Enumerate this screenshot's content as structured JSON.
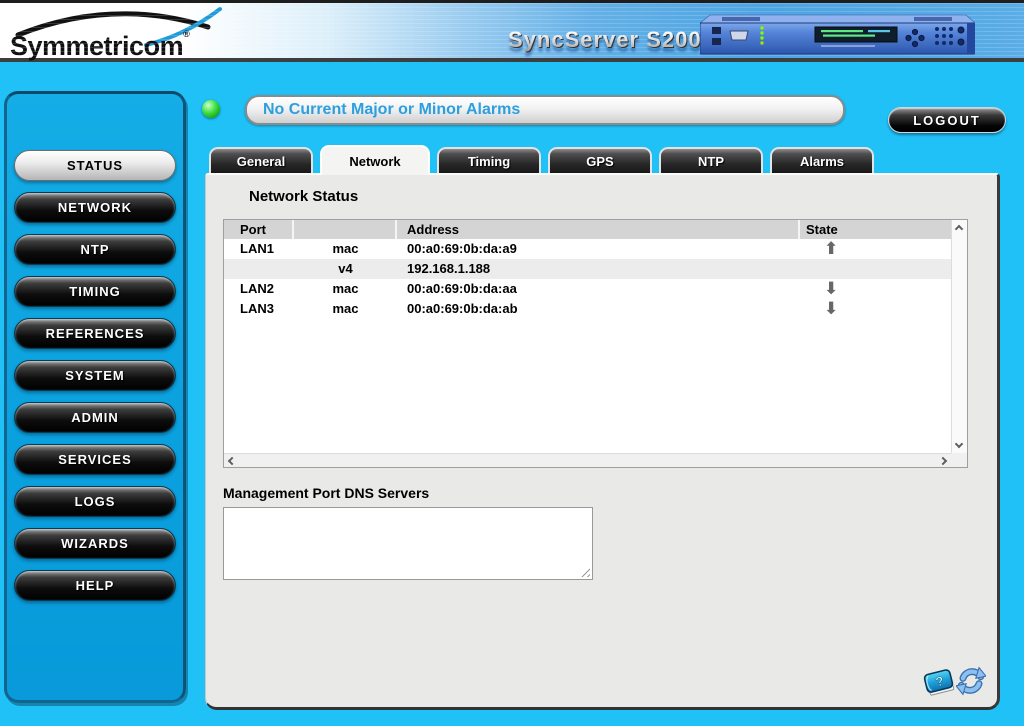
{
  "header": {
    "brand": "Symmetricom",
    "registered": "®",
    "product_title": "SyncServer S200"
  },
  "status_bar": {
    "alarm_text": "No Current Major or Minor Alarms",
    "led_state": "ok-green",
    "logout_label": "LOGOUT"
  },
  "sidebar": {
    "items": [
      {
        "label": "STATUS",
        "active": true
      },
      {
        "label": "NETWORK",
        "active": false
      },
      {
        "label": "NTP",
        "active": false
      },
      {
        "label": "TIMING",
        "active": false
      },
      {
        "label": "REFERENCES",
        "active": false
      },
      {
        "label": "SYSTEM",
        "active": false
      },
      {
        "label": "ADMIN",
        "active": false
      },
      {
        "label": "SERVICES",
        "active": false
      },
      {
        "label": "LOGS",
        "active": false
      },
      {
        "label": "WIZARDS",
        "active": false
      },
      {
        "label": "HELP",
        "active": false
      }
    ]
  },
  "tabs": {
    "items": [
      {
        "label": "General",
        "active": false
      },
      {
        "label": "Network",
        "active": true
      },
      {
        "label": "Timing",
        "active": false
      },
      {
        "label": "GPS",
        "active": false
      },
      {
        "label": "NTP",
        "active": false
      },
      {
        "label": "Alarms",
        "active": false
      }
    ]
  },
  "network_status": {
    "title": "Network Status",
    "table": {
      "headers": {
        "port": "Port",
        "type": "",
        "address": "Address",
        "state": "State"
      },
      "rows": [
        {
          "port": "LAN1",
          "type": "mac",
          "address": "00:a0:69:0b:da:a9",
          "state": "up",
          "state_glyph": "⬆"
        },
        {
          "port": "",
          "type": "v4",
          "address": "192.168.1.188",
          "state": "",
          "state_glyph": ""
        },
        {
          "port": "LAN2",
          "type": "mac",
          "address": "00:a0:69:0b:da:aa",
          "state": "down",
          "state_glyph": "⬇"
        },
        {
          "port": "LAN3",
          "type": "mac",
          "address": "00:a0:69:0b:da:ab",
          "state": "down",
          "state_glyph": "⬇"
        }
      ]
    }
  },
  "dns_section": {
    "label": "Management Port DNS Servers",
    "value": ""
  },
  "colors": {
    "background": "#1FC1F6",
    "sidebar_blue": "#0AA0DE",
    "panel_gray": "#E9E9E7",
    "alarm_text_blue": "#2B9FE0",
    "table_header_gray": "#D4D4D4",
    "led_green": "#3EDE3E",
    "arrow_gray": "#676767"
  }
}
